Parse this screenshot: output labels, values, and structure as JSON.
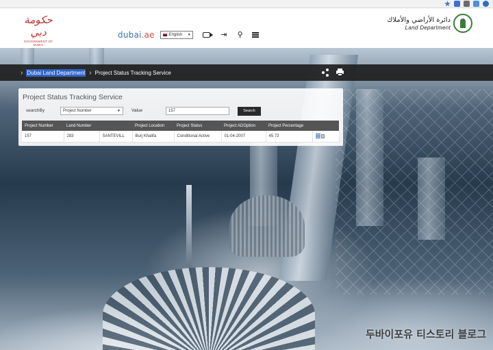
{
  "header": {
    "gov_logo_ar": "حكومة دبي",
    "gov_logo_en": "GOVERNMENT OF DUBAI",
    "dld_logo_ar": "دائرة الأراضي والأملاك",
    "dld_logo_en": "Land Department",
    "portal_name": "dubai",
    "portal_suffix": ".ae",
    "language": "English"
  },
  "breadcrumb": {
    "home": "Dubai Land Department",
    "current": "Project Status Tracking Service"
  },
  "panel": {
    "title": "Project Status Tracking Service",
    "search_by_label": "searchBy",
    "search_by_value": "Project Number",
    "value_label": "Value",
    "value_input": "157",
    "search_button": "Search"
  },
  "table": {
    "headers": [
      "Project Number",
      "Land Number",
      "",
      "Project Location",
      "Project Status",
      "Project ADOption",
      "Project Percentage",
      ""
    ],
    "rows": [
      {
        "project_number": "157",
        "land_number": "283",
        "community": "SANTEVILL",
        "location": "Burj Khalifa",
        "status": "Conditional Active",
        "adoption": "01-04-2007",
        "percentage": "45.73"
      }
    ]
  },
  "watermark": "두바이포유 티스토리 블로그",
  "colors": {
    "accent_red": "#c0302f",
    "bar_dark": "#1e1e1e",
    "table_header": "#555555",
    "link_highlight": "#2f64c8"
  },
  "icons": [
    "video-icon",
    "login-icon",
    "search-icon",
    "menu-icon",
    "share-icon",
    "print-icon",
    "details-icon"
  ]
}
